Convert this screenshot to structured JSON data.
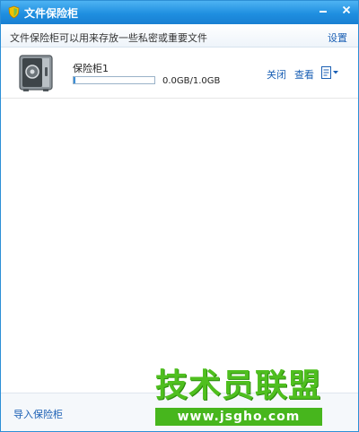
{
  "window": {
    "title": "文件保险柜"
  },
  "infobar": {
    "description": "文件保险柜可以用来存放一些私密或重要文件",
    "settings_label": "设置"
  },
  "vault": {
    "name": "保险柜1",
    "usage_text": "0.0GB/1.0GB",
    "usage_fraction": 0.02,
    "close_label": "关闭",
    "view_label": "查看",
    "more_icon": "document-dropdown-icon"
  },
  "footer": {
    "import_label": "导入保险柜"
  },
  "watermark": {
    "main_text": "技术员联盟",
    "url_text": "www.jsgho.com"
  },
  "colors": {
    "titlebar": "#1f8fe0",
    "link": "#1a5fb4",
    "watermark_green": "#4fbf1f"
  }
}
